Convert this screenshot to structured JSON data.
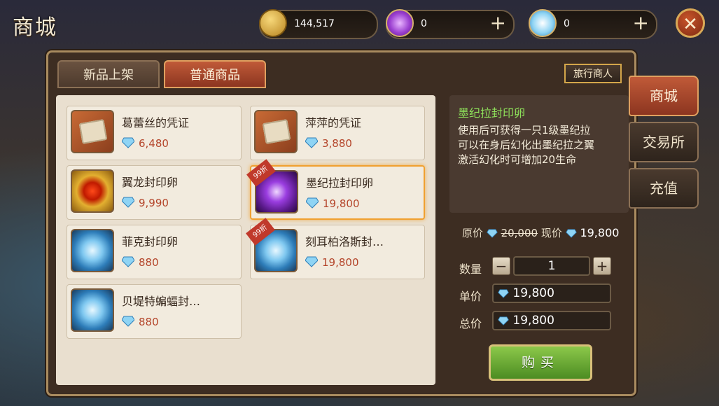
{
  "window": {
    "title": "商城"
  },
  "currencies": [
    {
      "icon": "gold-coin-icon",
      "value": "144,517",
      "has_plus": false
    },
    {
      "icon": "purple-gem-icon",
      "value": "0",
      "has_plus": true
    },
    {
      "icon": "diamond-icon",
      "value": "0",
      "has_plus": true
    }
  ],
  "tabs": [
    {
      "label": "新品上架",
      "active": false
    },
    {
      "label": "普通商品",
      "active": true
    }
  ],
  "merchant_button": "旅行商人",
  "items": [
    {
      "name": "葛蕾丝的凭证",
      "price": "6,480",
      "icon": "scroll-icon",
      "discount": ""
    },
    {
      "name": "萍萍的凭证",
      "price": "3,880",
      "icon": "scroll-icon",
      "discount": ""
    },
    {
      "name": "翼龙封印卵",
      "price": "9,990",
      "icon": "gold-egg-icon",
      "discount": ""
    },
    {
      "name": "墨纪拉封印卵",
      "price": "19,800",
      "icon": "purple-egg-icon",
      "discount": "99折",
      "selected": true
    },
    {
      "name": "菲克封印卵",
      "price": "880",
      "icon": "blue-egg-icon",
      "discount": ""
    },
    {
      "name": "刻耳柏洛斯封…",
      "price": "19,800",
      "icon": "blue-egg-icon",
      "discount": "99折"
    },
    {
      "name": "贝堤特蝙蝠封…",
      "price": "880",
      "icon": "blue-egg-icon",
      "discount": ""
    }
  ],
  "detail": {
    "title": "墨纪拉封印卵",
    "desc_lines": [
      "使用后可获得一只1级墨纪拉",
      "可以在身后幻化出墨纪拉之翼",
      "激活幻化时可增加20生命"
    ],
    "orig_label": "原价",
    "orig_price": "20,000",
    "now_label": "现价",
    "now_price": "19,800"
  },
  "purchase": {
    "qty_label": "数量",
    "qty": "1",
    "unit_label": "单价",
    "unit_price": "19,800",
    "total_label": "总价",
    "total_price": "19,800",
    "buy_label": "购买"
  },
  "side_tabs": [
    {
      "label": "商城",
      "active": true
    },
    {
      "label": "交易所",
      "active": false
    },
    {
      "label": "充值",
      "active": false
    }
  ],
  "colors": {
    "accent": "#c05a38",
    "price": "#b4452a",
    "detail_title": "#8ee05a",
    "buy": "#5ea52e"
  }
}
